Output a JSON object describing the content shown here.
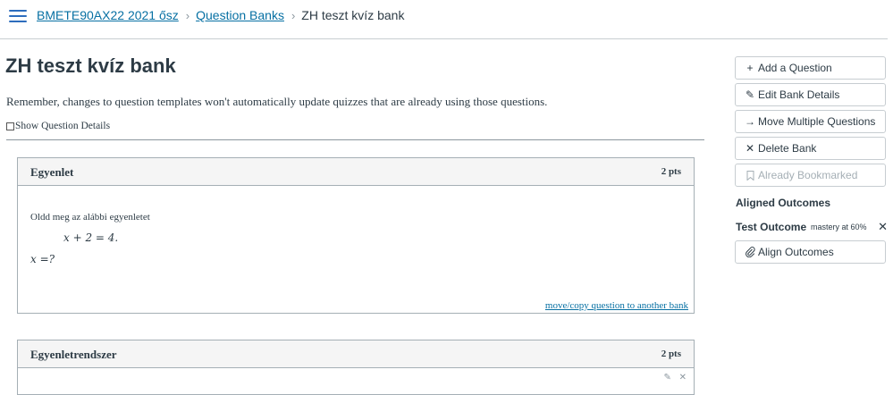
{
  "header": {
    "breadcrumbs": [
      {
        "label": "BMETE90AX22 2021 ősz"
      },
      {
        "label": "Question Banks"
      },
      {
        "label": "ZH teszt kvíz bank"
      }
    ]
  },
  "main": {
    "title": "ZH teszt kvíz bank",
    "notice": "Remember, changes to question templates won't automatically update quizzes that are already using those questions.",
    "show_details_label": "Show Question Details",
    "questions": [
      {
        "name": "Egyenlet",
        "points": "2 pts",
        "text": "Oldd meg az alábbi egyenletet",
        "equation": "𝑥 + 2 = 4.",
        "answer_prompt": "𝑥 =?",
        "move_link": "move/copy question to another bank"
      },
      {
        "name": "Egyenletrendszer",
        "points": "2 pts"
      }
    ]
  },
  "sidebar": {
    "buttons": [
      {
        "label": "Add a Question",
        "icon": "plus-icon"
      },
      {
        "label": "Edit Bank Details",
        "icon": "pencil-icon"
      },
      {
        "label": "Move Multiple Questions",
        "icon": "arrow-right-icon"
      },
      {
        "label": "Delete Bank",
        "icon": "x-icon"
      },
      {
        "label": "Already Bookmarked",
        "icon": "bookmark-icon",
        "disabled": true
      }
    ],
    "aligned_outcomes_title": "Aligned Outcomes",
    "outcome": {
      "name": "Test Outcome",
      "mastery": "mastery at 60%"
    },
    "align_button": {
      "label": "Align Outcomes",
      "icon": "paperclip-icon"
    }
  },
  "colors": {
    "link": "#0770a3",
    "text": "#2d3b45",
    "border": "#c7cdd1",
    "card_header_bg": "#f5f5f5"
  }
}
